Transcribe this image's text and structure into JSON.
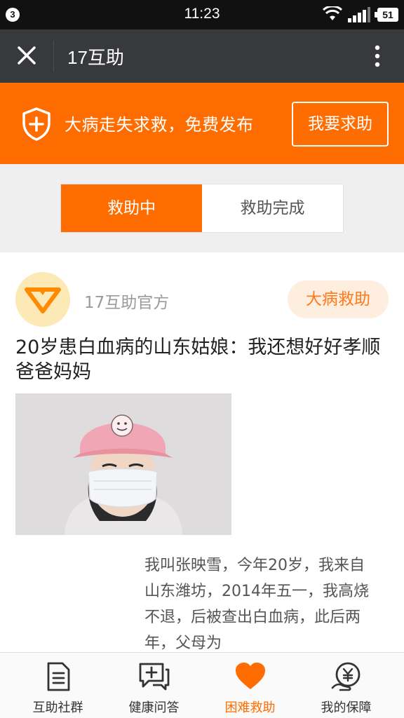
{
  "status_bar": {
    "notification_count": "3",
    "time": "11:23",
    "battery": "51"
  },
  "nav": {
    "title": "17互助",
    "close_icon": "close-icon",
    "more_icon": "more-vertical-icon"
  },
  "banner": {
    "icon": "shield-plus-icon",
    "text": "大病走失求救，免费发布",
    "button_label": "我要求助",
    "background": "#ff6d00"
  },
  "segmented": {
    "tabs": [
      {
        "label": "救助中",
        "active": true
      },
      {
        "label": "救助完成",
        "active": false
      }
    ]
  },
  "post": {
    "author": "17互助官方",
    "tag": "大病救助",
    "title": "20岁患白血病的山东姑娘：我还想好好孝顺爸爸妈妈",
    "excerpt": "我叫张映雪，今年20岁，我来自山东潍坊，2014年五一，我高烧不退，后被查出白血病，此后两年，父母为"
  },
  "tab_bar": {
    "items": [
      {
        "label": "互助社群",
        "icon": "document-icon",
        "active": false
      },
      {
        "label": "健康问答",
        "icon": "chat-plus-icon",
        "active": false
      },
      {
        "label": "困难救助",
        "icon": "heart-icon",
        "active": true
      },
      {
        "label": "我的保障",
        "icon": "yen-hand-icon",
        "active": false
      }
    ]
  },
  "colors": {
    "accent": "#ff6d00",
    "navbar": "#38393c",
    "tag_bg": "#fdeee0"
  }
}
